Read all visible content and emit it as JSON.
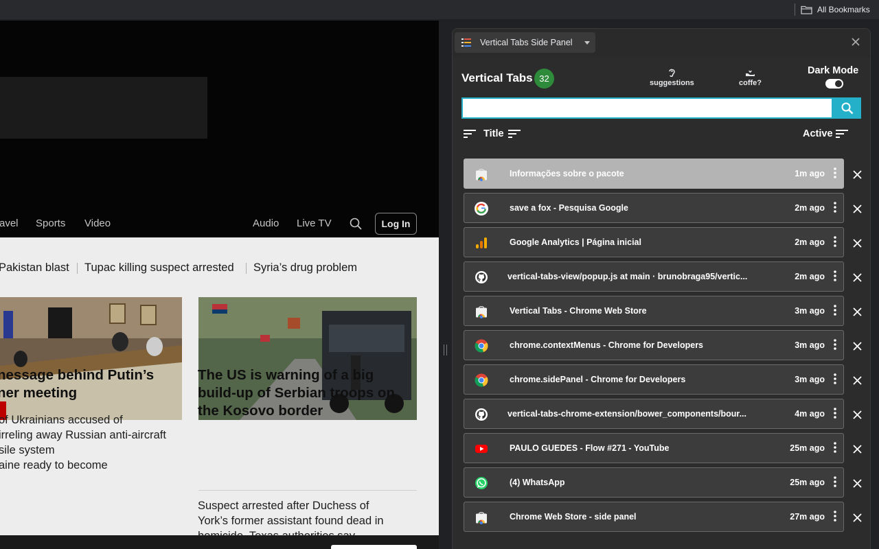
{
  "bookmarks": {
    "all_label": "All Bookmarks"
  },
  "webpage": {
    "nav": [
      "avel",
      "Sports",
      "Video",
      "Audio",
      "Live TV"
    ],
    "login": "Log In",
    "ticker": [
      "Pakistan blast",
      "Tupac killing suspect arrested",
      "Syria’s drug problem"
    ],
    "story1": {
      "headline": [
        "nessage behind Putin’s",
        "ner meeting"
      ],
      "sub": [
        "of Ukrainians accused of",
        "irreling away Russian anti-aircraft",
        "sile system",
        "aine ready to become"
      ]
    },
    "story2": {
      "headline": [
        "The US is warning of a big",
        "build-up of Serbian troops on",
        "the Kosovo border"
      ],
      "sub": [
        "Suspect arrested after Duchess of",
        "York’s former assistant found dead in",
        "homicide. Texas authorities say"
      ]
    }
  },
  "panel": {
    "selector_label": "Vertical Tabs Side Panel",
    "title": "Vertical Tabs",
    "tab_count": "32",
    "suggestions_label": "suggestions",
    "coffee_label": "coffe?",
    "dark_mode_label": "Dark Mode",
    "dark_mode_on": true,
    "search": {
      "value": "",
      "placeholder": ""
    },
    "sort": {
      "title_label": "Title",
      "active_label": "Active"
    },
    "colors": {
      "accent": "#23b0c8",
      "badge": "#2e8b3b",
      "row": "#3c3c3c",
      "active_row": "#b4b4b4"
    },
    "tabs": [
      {
        "title": "Informações sobre o pacote",
        "time": "1m ago",
        "favicon": "chrome-store-icon",
        "active": true
      },
      {
        "title": "save a fox - Pesquisa Google",
        "time": "2m ago",
        "favicon": "google-icon",
        "active": false
      },
      {
        "title": "Google Analytics | Página inicial",
        "time": "2m ago",
        "favicon": "analytics-icon",
        "active": false
      },
      {
        "title": "vertical-tabs-view/popup.js at main · brunobraga95/vertic...",
        "time": "2m ago",
        "favicon": "github-icon",
        "active": false
      },
      {
        "title": "Vertical Tabs - Chrome Web Store",
        "time": "3m ago",
        "favicon": "chrome-store-icon",
        "active": false
      },
      {
        "title": "chrome.contextMenus - Chrome for Developers",
        "time": "3m ago",
        "favicon": "chrome-icon",
        "active": false
      },
      {
        "title": "chrome.sidePanel - Chrome for Developers",
        "time": "3m ago",
        "favicon": "chrome-icon",
        "active": false
      },
      {
        "title": "vertical-tabs-chrome-extension/bower_components/bour...",
        "time": "4m ago",
        "favicon": "github-icon",
        "active": false
      },
      {
        "title": "PAULO GUEDES - Flow #271 - YouTube",
        "time": "25m ago",
        "favicon": "youtube-icon",
        "active": false
      },
      {
        "title": "(4) WhatsApp",
        "time": "25m ago",
        "favicon": "whatsapp-icon",
        "active": false
      },
      {
        "title": "Chrome Web Store - side panel",
        "time": "27m ago",
        "favicon": "chrome-store-icon",
        "active": false
      }
    ]
  }
}
